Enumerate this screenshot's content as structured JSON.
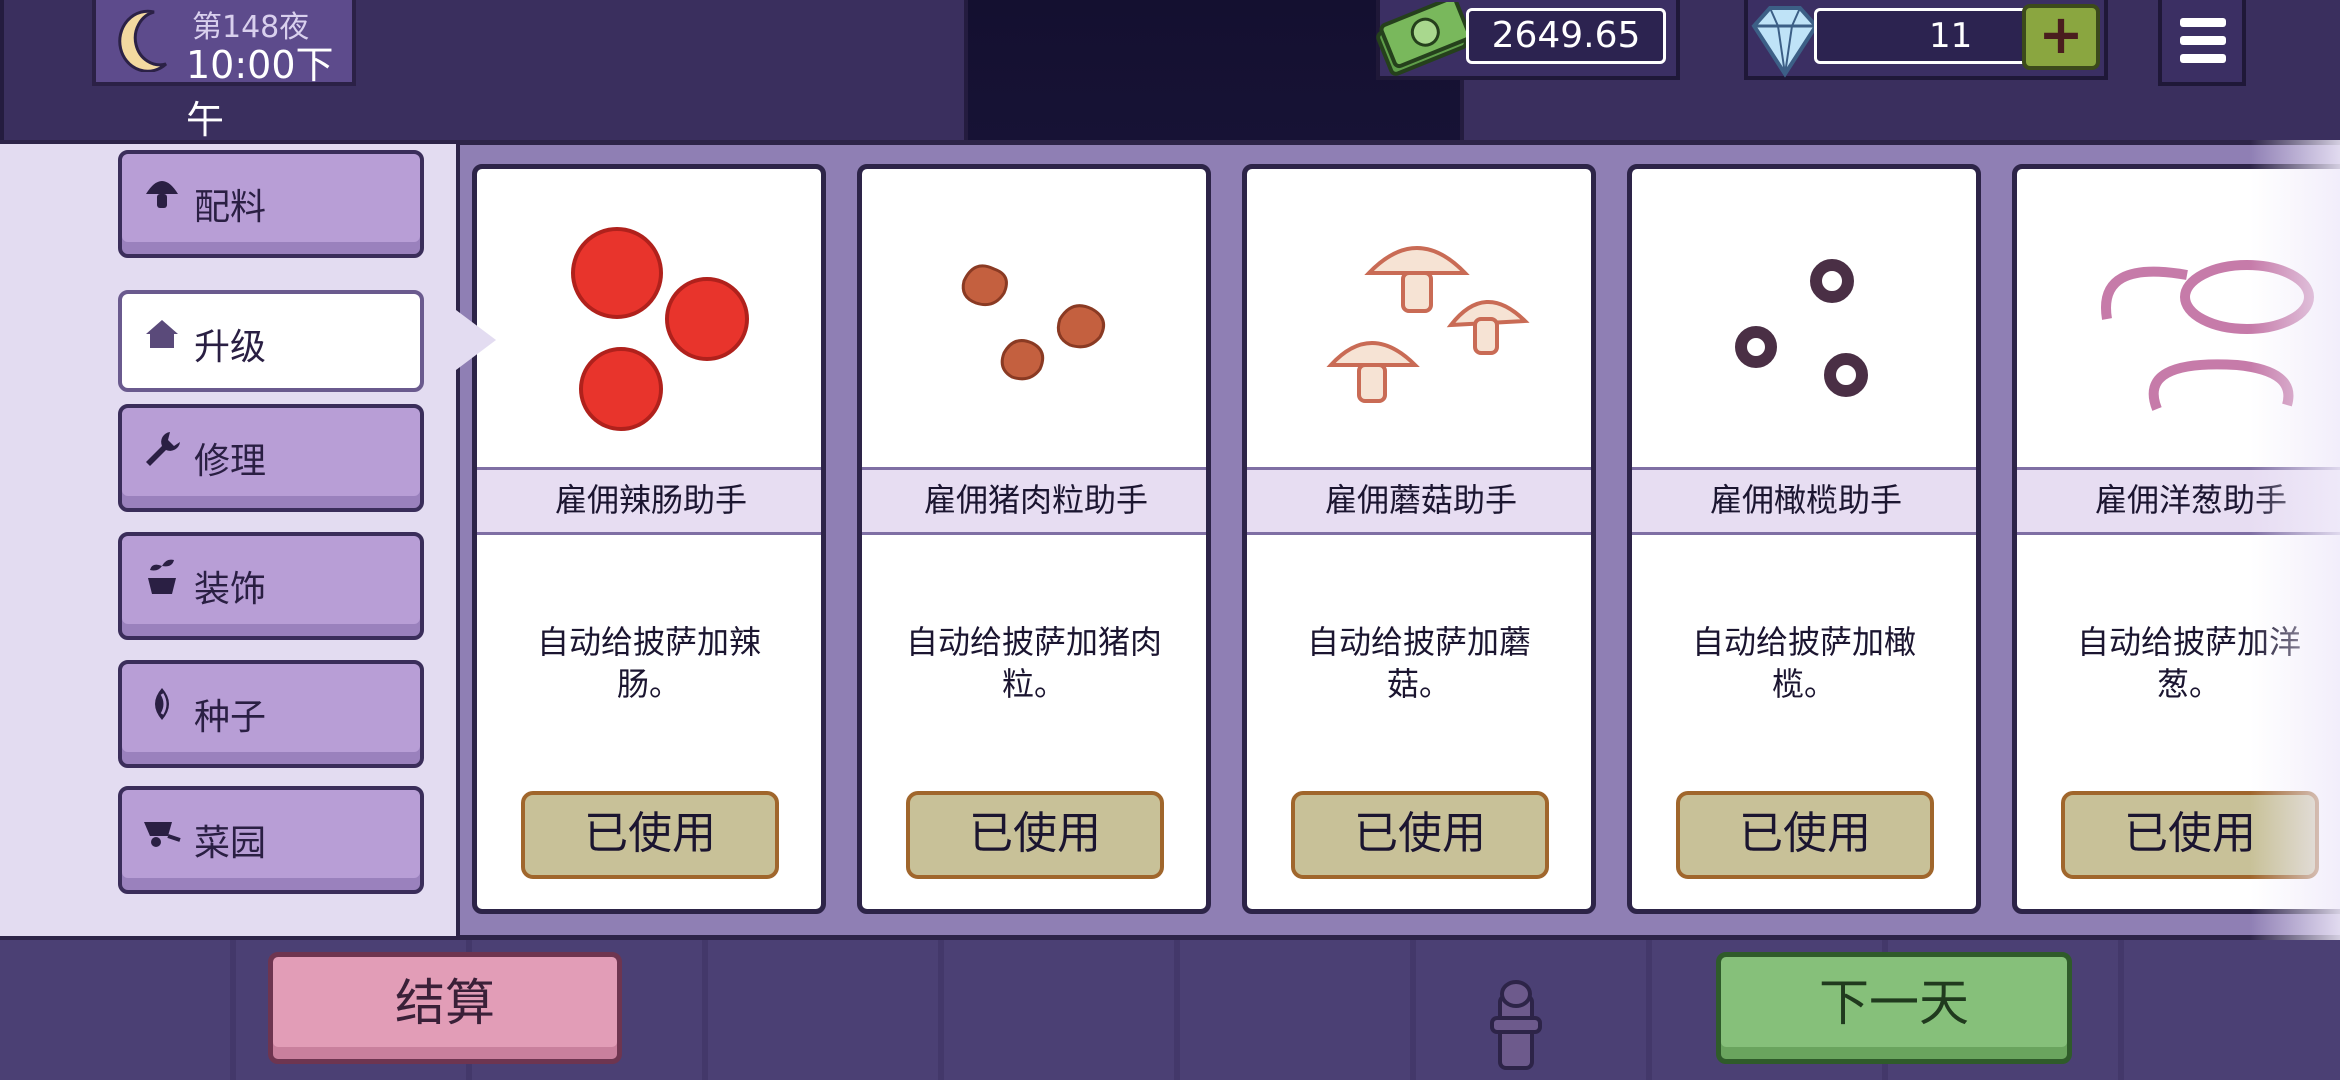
{
  "hud": {
    "night_label": "第148夜",
    "time": "10:00下午",
    "money": "2649.65",
    "gems": "11",
    "plus_label": "+"
  },
  "categories": [
    {
      "label": "配料",
      "icon": "mushroom-icon"
    },
    {
      "label": "升级",
      "icon": "house-icon",
      "active": true
    },
    {
      "label": "修理",
      "icon": "wrench-icon"
    },
    {
      "label": "装饰",
      "icon": "plant-icon"
    },
    {
      "label": "种子",
      "icon": "seed-icon"
    },
    {
      "label": "菜园",
      "icon": "wheelbarrow-icon"
    }
  ],
  "cards": [
    {
      "title": "雇佣辣肠助手",
      "desc": "自动给披萨加辣肠。",
      "button": "已使用",
      "art": "pepperoni-icon"
    },
    {
      "title": "雇佣猪肉粒助手",
      "desc": "自动给披萨加猪肉粒。",
      "button": "已使用",
      "art": "sausage-bits-icon"
    },
    {
      "title": "雇佣蘑菇助手",
      "desc": "自动给披萨加蘑菇。",
      "button": "已使用",
      "art": "mushrooms-icon"
    },
    {
      "title": "雇佣橄榄助手",
      "desc": "自动给披萨加橄榄。",
      "button": "已使用",
      "art": "olives-icon"
    },
    {
      "title": "雇佣洋葱助手",
      "desc": "自动给披萨加洋葱。",
      "button": "已使用",
      "art": "onions-icon"
    }
  ],
  "bottom": {
    "checkout": "结算",
    "next_day": "下一天"
  },
  "colors": {
    "panel": "#8f7fb4",
    "category_button": "#b89ed6",
    "used_button": "#c8c198",
    "checkout_button": "#e29db7",
    "next_day_button": "#86c07a"
  }
}
